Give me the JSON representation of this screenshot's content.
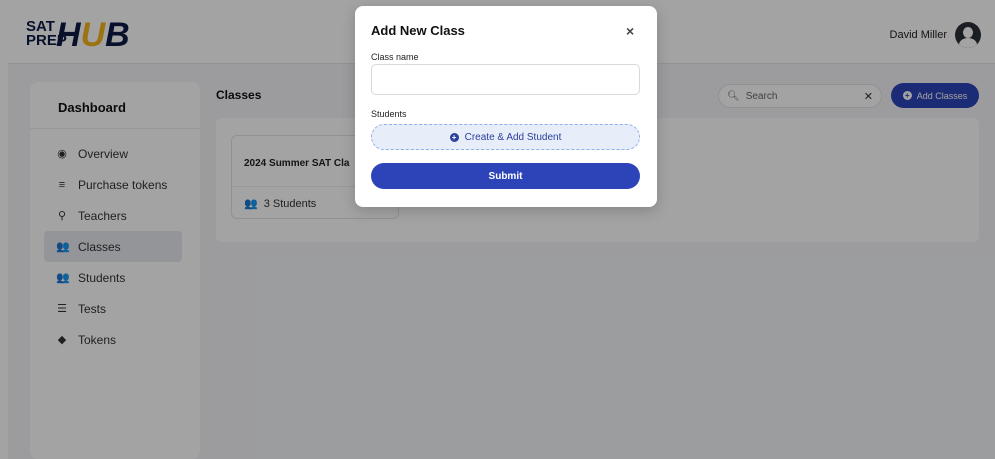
{
  "header": {
    "logo": {
      "line1": "SAT",
      "line2": "PREP",
      "word_start": "H",
      "word_u": "U",
      "word_end": "B"
    },
    "user_name": "David Miller"
  },
  "sidebar": {
    "title": "Dashboard",
    "items": [
      {
        "label": "Overview",
        "icon": "eye-icon"
      },
      {
        "label": "Purchase tokens",
        "icon": "coins-icon"
      },
      {
        "label": "Teachers",
        "icon": "teacher-icon"
      },
      {
        "label": "Classes",
        "icon": "users-icon",
        "active": true
      },
      {
        "label": "Students",
        "icon": "users-icon"
      },
      {
        "label": "Tests",
        "icon": "list-icon"
      },
      {
        "label": "Tokens",
        "icon": "tag-icon"
      }
    ]
  },
  "main": {
    "title": "Classes",
    "search": {
      "placeholder": "Search"
    },
    "add_button": "Add Classes",
    "class_card": {
      "name": "2024 Summer SAT Cla",
      "students": "3 Students"
    }
  },
  "modal": {
    "title": "Add New Class",
    "close": "×",
    "class_name_label": "Class name",
    "class_name_value": "",
    "students_label": "Students",
    "create_student_button": "Create & Add Student",
    "submit_button": "Submit"
  },
  "colors": {
    "primary": "#2d44b8",
    "logo_navy": "#0e1a45",
    "logo_accent": "#f2b51a"
  }
}
